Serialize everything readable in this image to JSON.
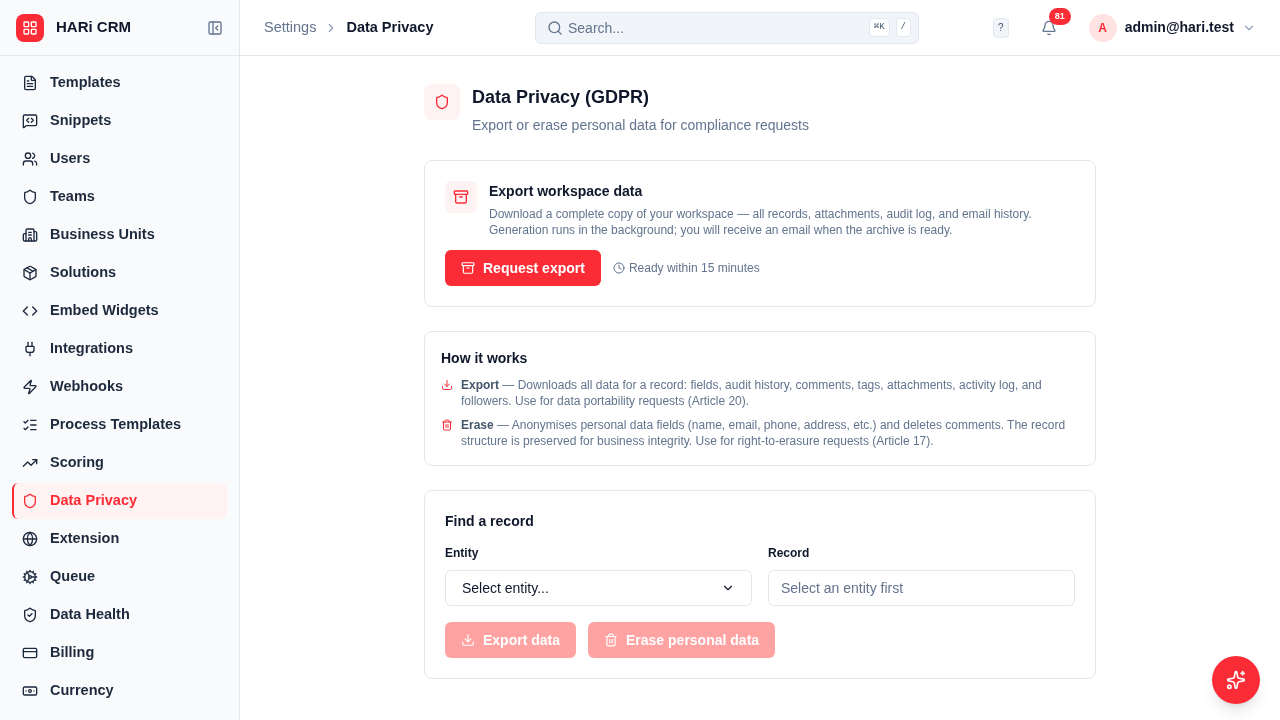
{
  "app": {
    "name": "HARi CRM"
  },
  "sidebar": {
    "items": [
      {
        "label": "Templates",
        "selected": false
      },
      {
        "label": "Snippets",
        "selected": false
      },
      {
        "label": "Users",
        "selected": false
      },
      {
        "label": "Teams",
        "selected": false
      },
      {
        "label": "Business Units",
        "selected": false
      },
      {
        "label": "Solutions",
        "selected": false
      },
      {
        "label": "Embed Widgets",
        "selected": false
      },
      {
        "label": "Integrations",
        "selected": false
      },
      {
        "label": "Webhooks",
        "selected": false
      },
      {
        "label": "Process Templates",
        "selected": false
      },
      {
        "label": "Scoring",
        "selected": false
      },
      {
        "label": "Data Privacy",
        "selected": true
      },
      {
        "label": "Extension",
        "selected": false
      },
      {
        "label": "Queue",
        "selected": false
      },
      {
        "label": "Data Health",
        "selected": false
      },
      {
        "label": "Billing",
        "selected": false
      },
      {
        "label": "Currency",
        "selected": false
      }
    ]
  },
  "header": {
    "breadcrumb": [
      "Settings",
      "Data Privacy"
    ],
    "search": {
      "placeholder": "Search...",
      "shortcuts": [
        "⌘K",
        "/"
      ]
    },
    "help": "?",
    "notifications": "81",
    "user": {
      "initial": "A",
      "email": "admin@hari.test"
    }
  },
  "page": {
    "title": "Data Privacy (GDPR)",
    "subtitle": "Export or erase personal data for compliance requests"
  },
  "export_card": {
    "title": "Export workspace data",
    "description": "Download a complete copy of your workspace — all records, attachments, audit log, and email history. Generation runs in the background; you will receive an email when the archive is ready.",
    "button": "Request export",
    "note": "Ready within 15 minutes"
  },
  "how_it_works": {
    "title": "How it works",
    "items": [
      {
        "kind": "export",
        "text": "**Export** — Downloads all data for a record: fields, audit history, comments, tags, attachments, activity log, and followers. Use for data portability requests (Article 20)."
      },
      {
        "kind": "erase",
        "text": "**Erase** — Anonymises personal data fields (name, email, phone, address, etc.) and deletes comments. The record structure is preserved for business integrity. Use for right-to-erasure requests (Article 17)."
      }
    ]
  },
  "find_record": {
    "title": "Find a record",
    "entity": {
      "label": "Entity",
      "value": "Select entity..."
    },
    "record": {
      "label": "Record",
      "placeholder": "Select an entity first"
    },
    "buttons": [
      {
        "kind": "export",
        "label": "Export data",
        "disabled": true
      },
      {
        "kind": "erase",
        "label": "Erase personal data",
        "disabled": true
      }
    ]
  }
}
